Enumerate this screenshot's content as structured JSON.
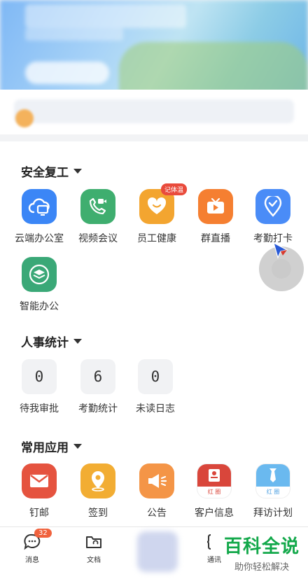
{
  "sections": {
    "safe": {
      "title": "安全复工",
      "apps": [
        {
          "label": "云端办公室",
          "color": "#3b86f6"
        },
        {
          "label": "视频会议",
          "color": "#3fae6f"
        },
        {
          "label": "员工健康",
          "color": "#f3a530",
          "tag": "记体温"
        },
        {
          "label": "群直播",
          "color": "#f57f31"
        },
        {
          "label": "考勤打卡",
          "color": "#4a8cf7"
        },
        {
          "label": "智能办公",
          "color": "#3aa877"
        }
      ]
    },
    "hr": {
      "title": "人事统计",
      "stats": [
        {
          "value": "0",
          "label": "待我审批"
        },
        {
          "value": "6",
          "label": "考勤统计"
        },
        {
          "value": "0",
          "label": "未读日志"
        }
      ]
    },
    "common": {
      "title": "常用应用",
      "apps": [
        {
          "label": "钉邮",
          "color": "#e5533f"
        },
        {
          "label": "签到",
          "color": "#f2ad33"
        },
        {
          "label": "公告",
          "color": "#f49547"
        },
        {
          "label": "客户信息",
          "color": "#d9463b",
          "sub": "红 圈"
        },
        {
          "label": "拜访计划",
          "color": "#6ab9ef",
          "sub": "红 圈"
        }
      ]
    }
  },
  "bottom_nav": {
    "messages": {
      "label": "消息",
      "badge": "32"
    },
    "docs": {
      "label": "文档"
    },
    "contacts": {
      "label": "通讯"
    }
  },
  "watermark": {
    "main": "百科全说",
    "sub": "助你轻松解决"
  }
}
